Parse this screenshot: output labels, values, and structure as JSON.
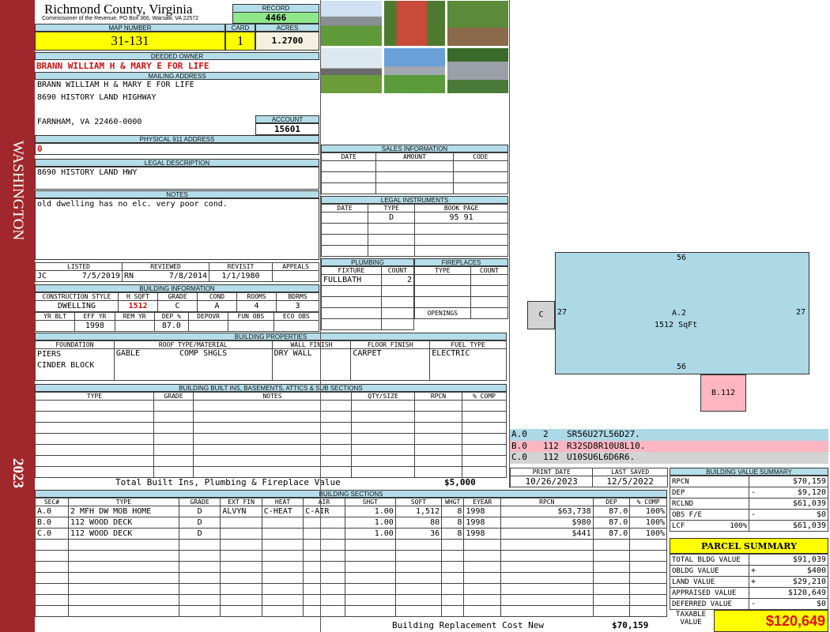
{
  "sidebar": {
    "district": "WASHINGTON",
    "year": "2023",
    "color": "#a0282c"
  },
  "header": {
    "county": "Richmond County, Virginia",
    "address": "Commissioner of the Revenue, PO Box 366, Warsaw, VA 22572",
    "record_label": "RECORD",
    "record": "4466",
    "map_label": "MAP NUMBER",
    "map_number": "31-131",
    "card_label": "CARD",
    "card": "1",
    "acres_label": "ACRES",
    "acres": "1.2700"
  },
  "owner": {
    "label": "DEEDED OWNER",
    "value": "BRANN WILLIAM H & MARY E FOR LIFE"
  },
  "mailing": {
    "label": "MAILING ADDRESS",
    "line1": "BRANN WILLIAM H & MARY E FOR LIFE",
    "line2": "8690 HISTORY LAND HIGHWAY",
    "line3": "FARNHAM, VA 22460-0000",
    "account_label": "ACCOUNT",
    "account": "15601"
  },
  "physical": {
    "label": "PHYSICAL 911 ADDRESS",
    "value": "0"
  },
  "legal": {
    "label": "LEGAL DESCRIPTION",
    "value": "8690 HISTORY LAND HWY"
  },
  "notes": {
    "label": "NOTES",
    "value": "old dwelling has no elc. very poor cond."
  },
  "review": {
    "listed_label": "LISTED",
    "listed_by": "JC",
    "listed": "7/5/2019",
    "reviewed_label": "REVIEWED",
    "reviewed_by": "RN",
    "reviewed": "7/8/2014",
    "revisit_label": "REVISIT",
    "revisit": "1/1/1980",
    "appeals_label": "APPEALS"
  },
  "building_info": {
    "label": "BUILDING INFORMATION",
    "h1": [
      "CONSTRUCTION STYLE",
      "H SQFT",
      "GRADE",
      "COND",
      "ROOMS",
      "BDRMS"
    ],
    "v1": [
      "DWELLING",
      "1512",
      "C",
      "A",
      "4",
      "3"
    ],
    "h2": [
      "YR BLT",
      "EFF YR",
      "REM YR",
      "DEP %",
      "DEPOVR",
      "FUN OBS",
      "ECO OBS"
    ],
    "v2": [
      "",
      "1998",
      "",
      "87.0",
      "",
      "",
      ""
    ]
  },
  "building_props": {
    "label": "BUILDING PROPERTIES",
    "headers": [
      "FOUNDATION",
      "ROOF TYPE/MATERIAL",
      "WALL FINISH",
      "FLOOR FINISH",
      "FUEL TYPE"
    ],
    "foundation": [
      "PIERS",
      "CINDER BLOCK"
    ],
    "roof_type": "GABLE",
    "roof_material": "COMP SHGLS",
    "wall": "DRY WALL",
    "floor": "CARPET",
    "fuel": "ELECTRIC"
  },
  "built_ins": {
    "label": "BUILDING BUILT INS, BASEMENTS, ATTICS & SUB SECTIONS",
    "headers": [
      "TYPE",
      "GRADE",
      "NOTES",
      "QTY/SIZE",
      "RPCN",
      "% COMP"
    ],
    "total_label": "Total Built Ins, Plumbing & Fireplace Value",
    "total": "$5,000"
  },
  "sections": {
    "label": "BUILDING SECTIONS",
    "headers": [
      "SEC#",
      "TYPE",
      "GRADE",
      "EXT FIN",
      "HEAT",
      "AIR",
      "SHGT",
      "SQFT",
      "WHGT",
      "EYEAR",
      "RPCN",
      "DEP",
      "% COMP"
    ],
    "rows": [
      [
        "A.0",
        "2 MFH DW MOB HOME",
        "D",
        "ALVYN",
        "C-HEAT",
        "C-AIR",
        "1.00",
        "1,512",
        "8",
        "1998",
        "$63,738",
        "87.0",
        "100%"
      ],
      [
        "B.0",
        "112 WOOD DECK",
        "D",
        "",
        "",
        "",
        "1.00",
        "80",
        "8",
        "1998",
        "$980",
        "87.0",
        "100%"
      ],
      [
        "C.0",
        "112 WOOD DECK",
        "D",
        "",
        "",
        "",
        "1.00",
        "36",
        "8",
        "1998",
        "$441",
        "87.0",
        "100%"
      ]
    ],
    "replacement_label": "Building Replacement Cost New",
    "replacement": "$70,159"
  },
  "sales": {
    "label": "SALES INFORMATION",
    "headers": [
      "DATE",
      "AMOUNT",
      "CODE"
    ]
  },
  "instruments": {
    "label": "LEGAL INSTRUMENTS",
    "headers": [
      "DATE",
      "TYPE",
      "BOOK PAGE"
    ],
    "rows": [
      [
        "",
        "D",
        "95 91"
      ]
    ]
  },
  "plumbing": {
    "label": "PLUMBING",
    "headers": [
      "FIXTURE",
      "COUNT"
    ],
    "rows": [
      [
        "FULLBATH",
        "2"
      ]
    ]
  },
  "fireplaces": {
    "label": "FIREPLACES",
    "headers": [
      "TYPE",
      "COUNT"
    ],
    "openings_label": "OPENINGS"
  },
  "dates": {
    "print_label": "PRINT DATE",
    "print": "10/26/2023",
    "saved_label": "LAST SAVED",
    "saved": "12/5/2022"
  },
  "sketch": {
    "main_label": "A.2",
    "main_area": "1512 SqFt",
    "top": "56",
    "bottom": "56",
    "left": "27",
    "right": "27",
    "c_label": "C",
    "b_label": "B.112",
    "legend": [
      {
        "code": "A.0",
        "type": "2",
        "vector": "SR56U27L56D27.",
        "color": "#add8e6"
      },
      {
        "code": "B.0",
        "type": "112",
        "vector": "R32SD8R10U8L10.",
        "color": "#ffb6c1"
      },
      {
        "code": "C.0",
        "type": "112",
        "vector": "U10SU6L6D6R6.",
        "color": "#d3d3d3"
      }
    ]
  },
  "value_summary": {
    "label": "BUILDING VALUE SUMMARY",
    "rows": [
      {
        "k": "RPCN",
        "op": "",
        "v": "$70,159"
      },
      {
        "k": "DEP",
        "op": "-",
        "v": "$9,120"
      },
      {
        "k": "RCLND",
        "op": "",
        "v": "$61,039"
      },
      {
        "k": "OBS F/E",
        "op": "-",
        "v": "$0"
      },
      {
        "k": "LCF",
        "pct": "100%",
        "op": "",
        "v": "$61,039"
      }
    ]
  },
  "parcel": {
    "label": "PARCEL SUMMARY",
    "rows": [
      {
        "k": "TOTAL BLDG VALUE",
        "op": "",
        "v": "$91,039"
      },
      {
        "k": "OBLDG VALUE",
        "op": "+",
        "v": "$400"
      },
      {
        "k": "LAND VALUE",
        "op": "+",
        "v": "$29,210"
      },
      {
        "k": "APPRAISED VALUE",
        "op": "",
        "v": "$120,649"
      },
      {
        "k": "DEFERRED VALUE",
        "op": "-",
        "v": "$0"
      }
    ],
    "taxable_label": "TAXABLE VALUE",
    "taxable": "$120,649"
  }
}
